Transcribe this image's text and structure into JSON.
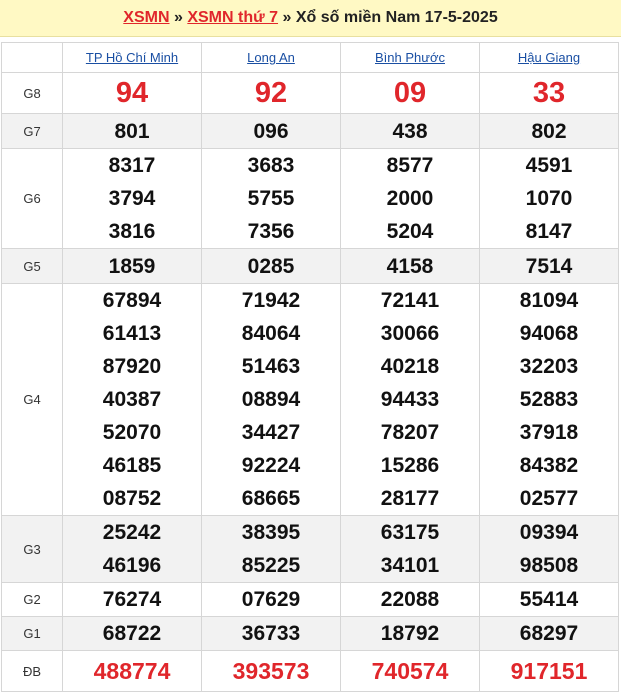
{
  "header": {
    "link1": "XSMN",
    "sep1": "»",
    "link2": "XSMN thứ 7",
    "sep2": "»",
    "text": "Xổ số miền Nam 17-5-2025"
  },
  "provinces": [
    "TP Hồ Chí Minh",
    "Long An",
    "Bình Phước",
    "Hậu Giang"
  ],
  "prizes": {
    "g8": {
      "label": "G8",
      "values": [
        [
          "94"
        ],
        [
          "92"
        ],
        [
          "09"
        ],
        [
          "33"
        ]
      ]
    },
    "g7": {
      "label": "G7",
      "values": [
        [
          "801"
        ],
        [
          "096"
        ],
        [
          "438"
        ],
        [
          "802"
        ]
      ]
    },
    "g6": {
      "label": "G6",
      "values": [
        [
          "8317",
          "3794",
          "3816"
        ],
        [
          "3683",
          "5755",
          "7356"
        ],
        [
          "8577",
          "2000",
          "5204"
        ],
        [
          "4591",
          "1070",
          "8147"
        ]
      ]
    },
    "g5": {
      "label": "G5",
      "values": [
        [
          "1859"
        ],
        [
          "0285"
        ],
        [
          "4158"
        ],
        [
          "7514"
        ]
      ]
    },
    "g4": {
      "label": "G4",
      "values": [
        [
          "67894",
          "61413",
          "87920",
          "40387",
          "52070",
          "46185",
          "08752"
        ],
        [
          "71942",
          "84064",
          "51463",
          "08894",
          "34427",
          "92224",
          "68665"
        ],
        [
          "72141",
          "30066",
          "40218",
          "94433",
          "78207",
          "15286",
          "28177"
        ],
        [
          "81094",
          "94068",
          "32203",
          "52883",
          "37918",
          "84382",
          "02577"
        ]
      ]
    },
    "g3": {
      "label": "G3",
      "values": [
        [
          "25242",
          "46196"
        ],
        [
          "38395",
          "85225"
        ],
        [
          "63175",
          "34101"
        ],
        [
          "09394",
          "98508"
        ]
      ]
    },
    "g2": {
      "label": "G2",
      "values": [
        [
          "76274"
        ],
        [
          "07629"
        ],
        [
          "22088"
        ],
        [
          "55414"
        ]
      ]
    },
    "g1": {
      "label": "G1",
      "values": [
        [
          "68722"
        ],
        [
          "36733"
        ],
        [
          "18792"
        ],
        [
          "68297"
        ]
      ]
    },
    "db": {
      "label": "ĐB",
      "values": [
        [
          "488774"
        ],
        [
          "393573"
        ],
        [
          "740574"
        ],
        [
          "917151"
        ]
      ]
    }
  }
}
